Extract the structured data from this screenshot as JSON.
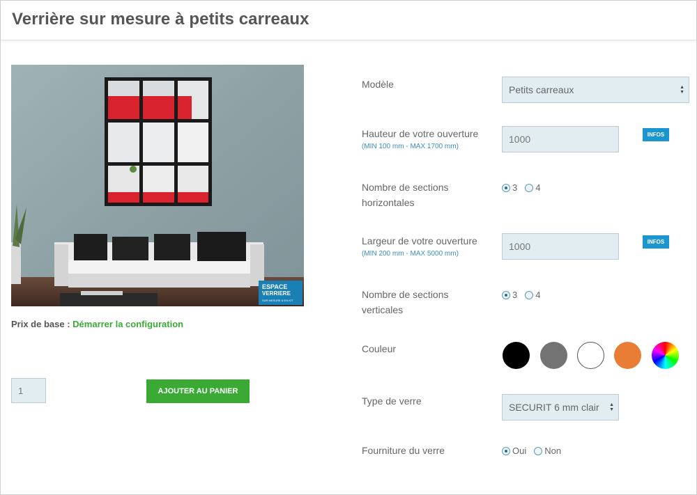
{
  "page": {
    "title": "Verrière sur mesure à petits carreaux"
  },
  "image": {
    "logo_line1": "ESPACE",
    "logo_line2": "VERRIERE",
    "logo_tagline": "SUR MESURE & EN KIT"
  },
  "pricing": {
    "base_label": "Prix de base : ",
    "start_link": "Démarrer la configuration"
  },
  "cart": {
    "quantity": "1",
    "add_label": "AJOUTER AU PANIER"
  },
  "form": {
    "model": {
      "label": "Modèle",
      "value": "Petits carreaux"
    },
    "height": {
      "label": "Hauteur de votre ouverture",
      "hint": "(MIN 100 mm - MAX 1700 mm)",
      "value": "1000",
      "info_label": "INFOS"
    },
    "h_sections": {
      "label_line1": "Nombre de sections",
      "label_line2": "horizontales",
      "options": [
        "3",
        "4"
      ],
      "selected": "3"
    },
    "width": {
      "label": "Largeur de votre ouverture",
      "hint": "(MIN 200 mm - MAX 5000 mm)",
      "value": "1000",
      "info_label": "INFOS"
    },
    "v_sections": {
      "label_line1": "Nombre de sections",
      "label_line2": "verticales",
      "options": [
        "3",
        "4"
      ],
      "selected": "3"
    },
    "color": {
      "label": "Couleur",
      "swatches": [
        {
          "name": "black",
          "hex": "#000000"
        },
        {
          "name": "grey",
          "hex": "#737373"
        },
        {
          "name": "white",
          "hex": "#ffffff"
        },
        {
          "name": "orange",
          "hex": "#ea7d35"
        },
        {
          "name": "custom-rainbow",
          "hex": "multicolor"
        }
      ]
    },
    "glass_type": {
      "label": "Type de verre",
      "value": "SECURIT 6 mm clair"
    },
    "glass_supply": {
      "label": "Fourniture du verre",
      "options": [
        "Oui",
        "Non"
      ],
      "selected": "Oui"
    }
  },
  "colors": {
    "accent_green": "#3aaa35",
    "info_blue": "#1a95d0",
    "hint_blue": "#3a8fc1",
    "input_bg": "#e1edf1"
  }
}
